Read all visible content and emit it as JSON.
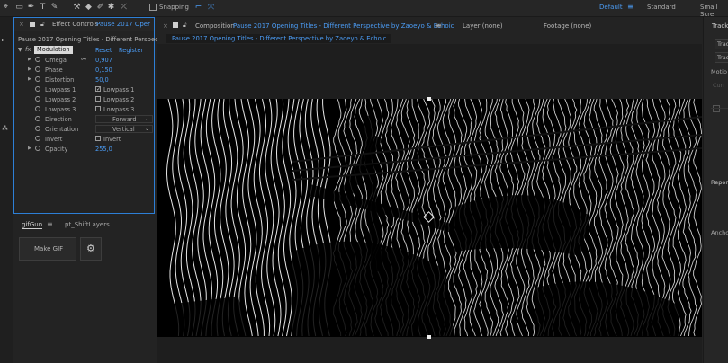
{
  "toolbar": {
    "snapping_label": "Snapping",
    "workspaces": [
      "Default",
      "Standard",
      "Small Scre"
    ],
    "active_workspace": "Default"
  },
  "effect_controls": {
    "tab_label": "Effect Controls",
    "tab_target": "Pause 2017 Oper",
    "layer_title": "Pause 2017 Opening Titles - Different Perspectiv",
    "effect_name": "Modulation",
    "reset_label": "Reset",
    "register_label": "Register",
    "properties": [
      {
        "name": "Omega",
        "value": "0,907",
        "type": "value",
        "expandable": true
      },
      {
        "name": "Phase",
        "value": "0,150",
        "type": "value",
        "expandable": true
      },
      {
        "name": "Distortion",
        "value": "50,0",
        "type": "value",
        "expandable": true
      },
      {
        "name": "Lowpass 1",
        "value": "Lowpass 1",
        "type": "checkbox",
        "checked": true
      },
      {
        "name": "Lowpass 2",
        "value": "Lowpass 2",
        "type": "checkbox",
        "checked": false
      },
      {
        "name": "Lowpass 3",
        "value": "Lowpass 3",
        "type": "checkbox",
        "checked": false
      },
      {
        "name": "Direction",
        "value": "Forward",
        "type": "dropdown"
      },
      {
        "name": "Orientation",
        "value": "Vertical",
        "type": "dropdown"
      },
      {
        "name": "Invert",
        "value": "Invert",
        "type": "checkbox",
        "checked": false
      },
      {
        "name": "Opacity",
        "value": "255,0",
        "type": "value",
        "expandable": true
      }
    ]
  },
  "gifgun": {
    "tabs": [
      "gifGun",
      "pt_ShiftLayers"
    ],
    "make_gif_label": "Make GIF"
  },
  "composition": {
    "tab_label": "Composition",
    "comp_name": "Pause 2017 Opening Titles - Different Perspective by Zaoeyo & Echoic",
    "layer_label": "Layer (none)",
    "footage_label": "Footage (none)",
    "sub_tab": "Pause 2017 Opening Titles - Different Perspective by Zaoeyo & Echoic"
  },
  "right_panel": {
    "title": "Track",
    "buttons": [
      "Trac",
      "Trac"
    ],
    "labels": [
      "Motio",
      "Curr",
      "Repor",
      "Ancho"
    ]
  },
  "colors": {
    "accent": "#4b9cf5",
    "panel_bg": "#232323",
    "viewer_bg": "#000000"
  }
}
